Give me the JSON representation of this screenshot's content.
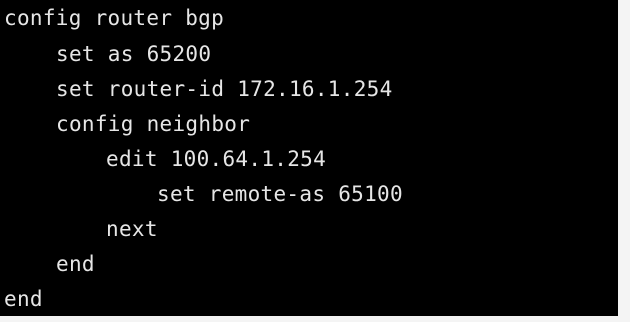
{
  "terminal": {
    "lines": [
      "config router bgp",
      "set as 65200",
      "set router-id 172.16.1.254",
      "config neighbor",
      "edit 100.64.1.254",
      "set remote-as 65100",
      "next",
      "end",
      "end"
    ]
  },
  "colors": {
    "background": "#000000",
    "text": "#e6e6e6"
  }
}
